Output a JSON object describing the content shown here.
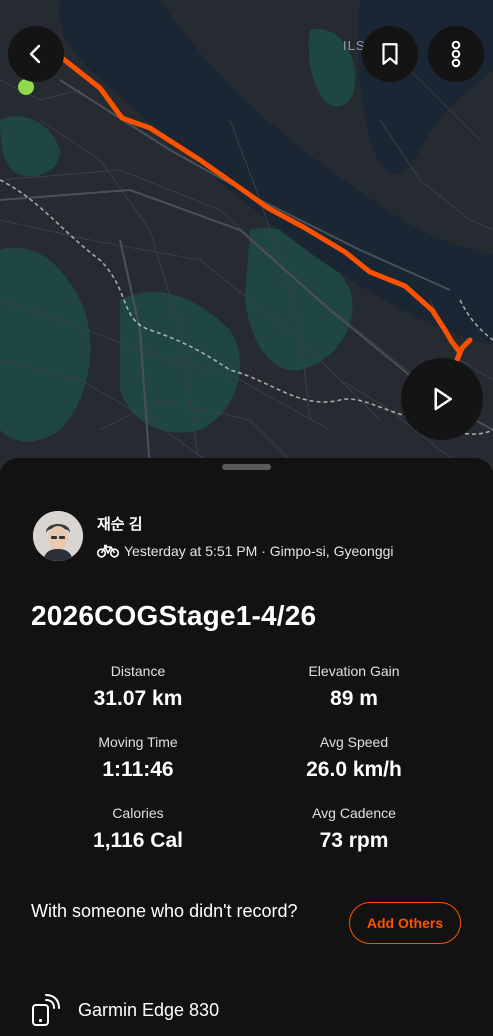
{
  "map": {
    "place_label": "ILS      W",
    "route_color": "#fc5200",
    "start_marker_color": "#8ed94c",
    "buttons": {
      "back": "chevron-left-icon",
      "bookmark": "bookmark-icon",
      "more": "more-vertical-icon",
      "play": "play-icon"
    }
  },
  "activity": {
    "athlete_name": "재순 김",
    "meta_text": "Yesterday at 5:51 PM · Gimpo-si, Gyeonggi",
    "title": "2026COGStage1-4/26",
    "stats": [
      {
        "label": "Distance",
        "value": "31.07 km"
      },
      {
        "label": "Elevation Gain",
        "value": "89 m"
      },
      {
        "label": "Moving Time",
        "value": "1:11:46"
      },
      {
        "label": "Avg Speed",
        "value": "26.0 km/h"
      },
      {
        "label": "Calories",
        "value": "1,116 Cal"
      },
      {
        "label": "Avg Cadence",
        "value": "73 rpm"
      }
    ],
    "others_prompt": "With someone who didn't record?",
    "add_others_label": "Add Others",
    "device_name": "Garmin Edge 830"
  },
  "colors": {
    "accent": "#fc5200",
    "background": "#121212"
  }
}
